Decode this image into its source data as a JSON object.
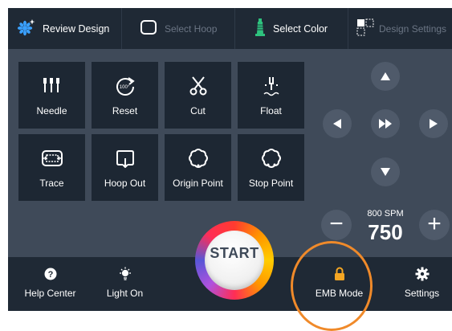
{
  "tabs": [
    {
      "label": "Review Design",
      "icon": "review-design-icon",
      "enabled": true
    },
    {
      "label": "Select Hoop",
      "icon": "hoop-icon",
      "enabled": false
    },
    {
      "label": "Select Color",
      "icon": "thread-spool-icon",
      "enabled": true
    },
    {
      "label": "Design Settings",
      "icon": "design-settings-icon",
      "enabled": false
    }
  ],
  "tools": [
    {
      "label": "Needle",
      "icon": "needle-icon"
    },
    {
      "label": "Reset",
      "icon": "reset-icon",
      "badge": "100°"
    },
    {
      "label": "Cut",
      "icon": "scissors-icon"
    },
    {
      "label": "Float",
      "icon": "float-icon"
    },
    {
      "label": "Trace",
      "icon": "trace-icon"
    },
    {
      "label": "Hoop Out",
      "icon": "hoop-out-icon"
    },
    {
      "label": "Origin Point",
      "icon": "origin-point-icon"
    },
    {
      "label": "Stop Point",
      "icon": "stop-point-icon"
    }
  ],
  "speed": {
    "unit_label": "800 SPM",
    "value": "750",
    "minus": "−",
    "plus": "+"
  },
  "start": {
    "label": "START"
  },
  "bottom": [
    {
      "label": "Help Center",
      "icon": "help-icon"
    },
    {
      "label": "Light On",
      "icon": "light-icon"
    },
    {
      "label": "EMB Mode",
      "icon": "lock-icon"
    },
    {
      "label": "Settings",
      "icon": "gear-icon"
    }
  ],
  "colors": {
    "panel": "#3f4a59",
    "bar": "#1f2935",
    "button": "#1d2733",
    "accent_orange": "#f08a2a",
    "lock_yellow": "#f5a623",
    "spool_green": "#2ec27e"
  }
}
